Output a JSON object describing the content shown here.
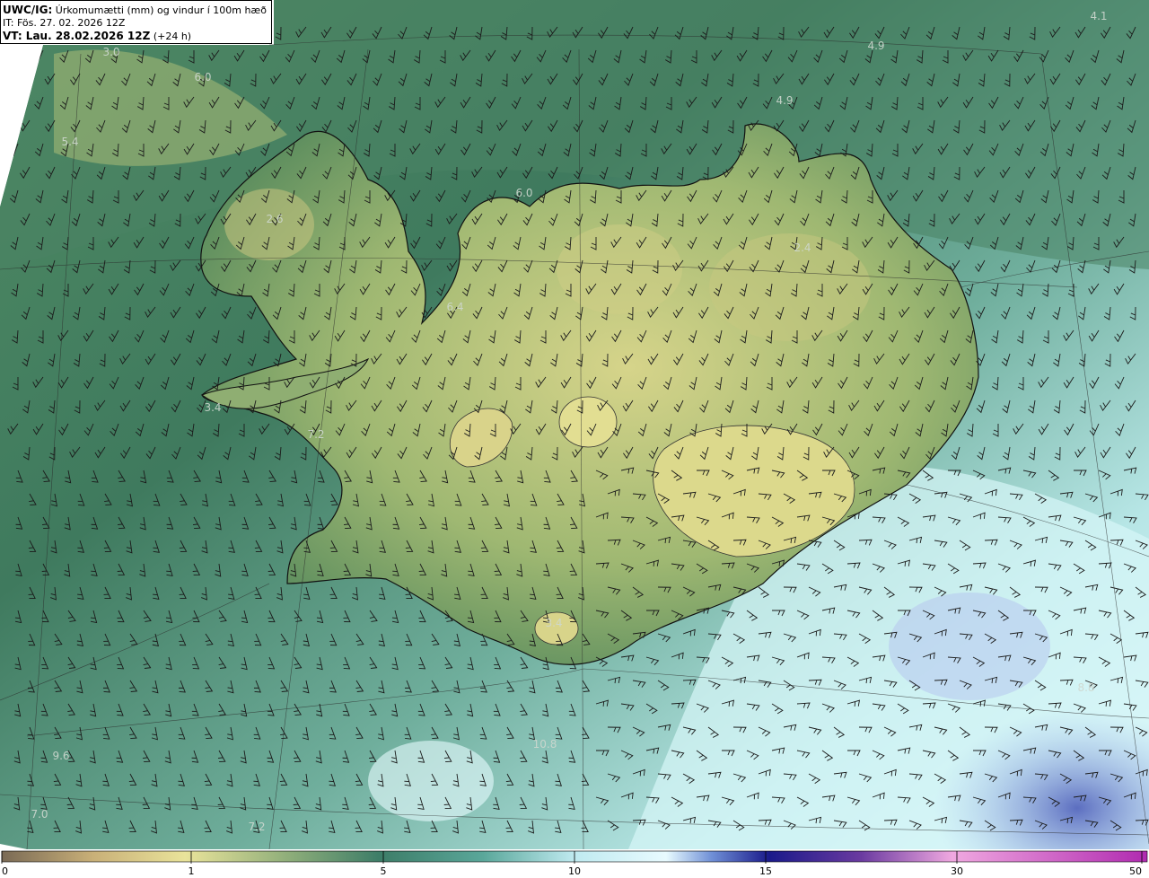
{
  "header": {
    "product": "UWC/IG:",
    "title": "Úrkomumætti (mm) og vindur í 100m hæð",
    "init_time": "IT: Fös. 27. 02. 2026 12Z",
    "valid_label": "VT: Lau. 28.02.2026 12Z",
    "lead": "(+24 h)"
  },
  "precip_labels": [
    {
      "text": "4.1"
    },
    {
      "text": "4.9"
    },
    {
      "text": "3.0"
    },
    {
      "text": "6.0"
    },
    {
      "text": "4.9"
    },
    {
      "text": "5.4"
    },
    {
      "text": "6.0"
    },
    {
      "text": "2.6"
    },
    {
      "text": "2.4"
    },
    {
      "text": "6.4"
    },
    {
      "text": "3.4"
    },
    {
      "text": "7.2"
    },
    {
      "text": "3.4"
    },
    {
      "text": "9.6"
    },
    {
      "text": "10.8"
    },
    {
      "text": "7.0"
    },
    {
      "text": "7.2"
    },
    {
      "text": "8.8"
    }
  ],
  "colorbar": {
    "ticks": [
      "0",
      "1",
      "5",
      "10",
      "15",
      "30",
      "50"
    ],
    "colors": [
      "#7a6a55",
      "#c9b078",
      "#e9e39a",
      "#8fae7a",
      "#3d7d68",
      "#5aa79a",
      "#bfeaf0",
      "#e8fbff",
      "#6f8fd6",
      "#1a1a8a",
      "#6a3aa0",
      "#f0a8e0",
      "#b02ab0"
    ]
  },
  "legend_colors": {
    "land_high": "#d8d68a",
    "land_mid": "#8fae72",
    "sea_north": "#3f7a5e",
    "sea_south": "#9fd6d2",
    "sea_southeast": "#dff8fb",
    "heavy_precip": "#7081c8",
    "coastline": "#111111",
    "barbs": "#1b1b1b"
  },
  "icons": {
    "wind_barb": "wind-barb-icon"
  }
}
